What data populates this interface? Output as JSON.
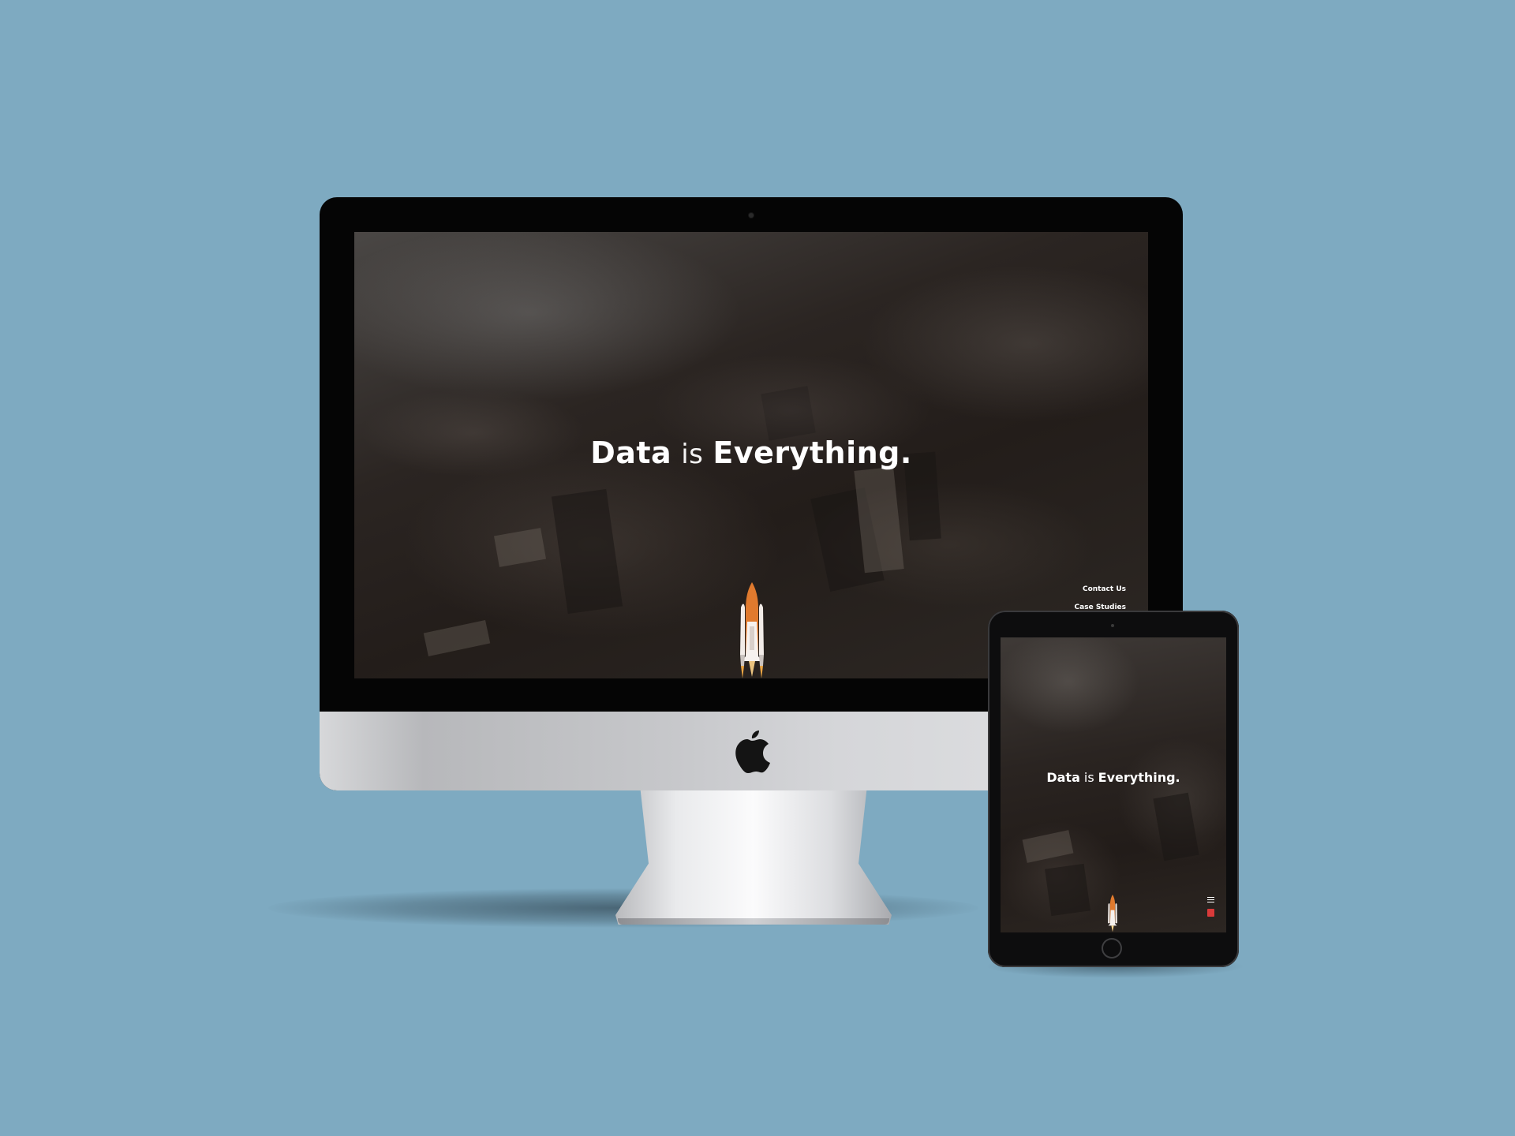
{
  "desktop": {
    "hero": {
      "word1": "Data",
      "word2": "is",
      "word3": "Everything."
    },
    "nav": {
      "contact_label": "Contact Us",
      "case_studies_label": "Case Studies"
    }
  },
  "tablet": {
    "hero": {
      "word1": "Data",
      "word2": "is",
      "word3": "Everything."
    }
  },
  "icons": {
    "device_logo": "apple-logo",
    "mascot": "space-shuttle-icon",
    "mobile_menu": "hamburger-menu-icon",
    "mobile_badge": "red-badge-icon"
  },
  "colors": {
    "background": "#7eaac1",
    "hero_text": "#ffffff",
    "accent": "#d93a3a"
  }
}
